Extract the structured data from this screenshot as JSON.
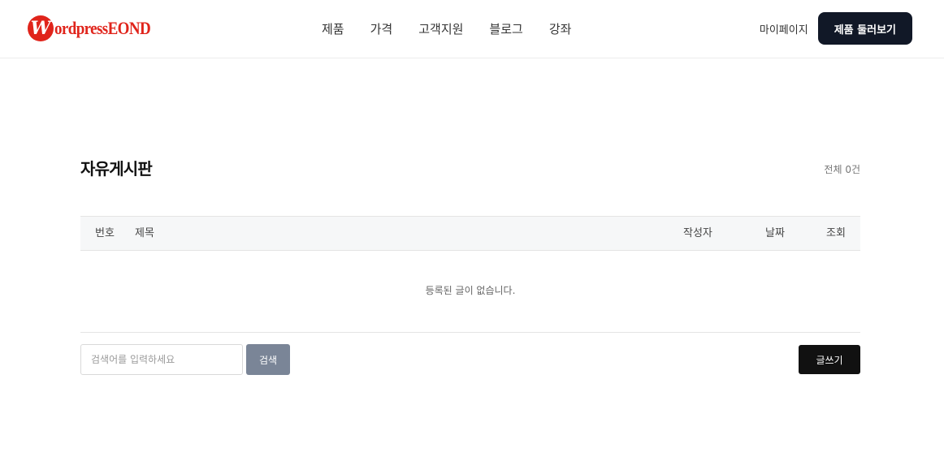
{
  "header": {
    "logo": {
      "mark": "W",
      "text": "ordpressEOND"
    },
    "nav": [
      {
        "label": "제품"
      },
      {
        "label": "가격"
      },
      {
        "label": "고객지원"
      },
      {
        "label": "블로그"
      },
      {
        "label": "강좌"
      }
    ],
    "mypage_label": "마이페이지",
    "tour_button_label": "제품 둘러보기"
  },
  "board": {
    "title": "자유게시판",
    "count_label": "전체 0건",
    "columns": {
      "number": "번호",
      "title": "제목",
      "author": "작성자",
      "date": "날짜",
      "views": "조회"
    },
    "empty_message": "등록된 글이 없습니다.",
    "search": {
      "placeholder": "검색어를 입력하세요",
      "value": "",
      "button_label": "검색"
    },
    "write_button_label": "글쓰기"
  },
  "colors": {
    "brand": "#e0241b",
    "primary_button": "#111827",
    "search_button": "#7a8597",
    "table_header_bg": "#f6f7f8"
  }
}
